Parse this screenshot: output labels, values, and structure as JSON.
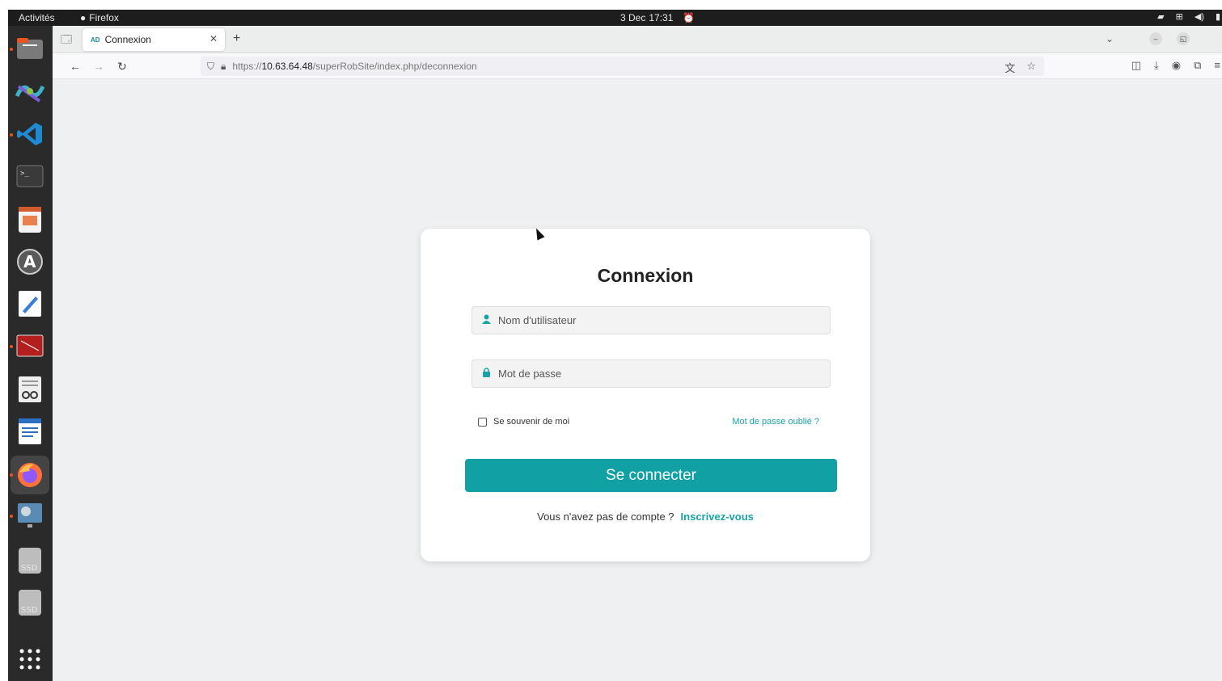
{
  "topbar": {
    "activities": "Activités",
    "app_name": "Firefox",
    "date": "3 Dec",
    "time": "17:31"
  },
  "dock": {
    "items": [
      {
        "icon": "files-icon"
      },
      {
        "icon": "ros-icon"
      },
      {
        "icon": "vscode-icon"
      },
      {
        "icon": "terminal-icon"
      },
      {
        "icon": "impress-icon"
      },
      {
        "icon": "software-icon"
      },
      {
        "icon": "text-editor-icon"
      },
      {
        "icon": "remote-desktop-icon"
      },
      {
        "icon": "document-viewer-icon"
      },
      {
        "icon": "writer-icon"
      },
      {
        "icon": "firefox-icon"
      },
      {
        "icon": "simulator-icon"
      },
      {
        "icon": "drive-icon",
        "label": "SSD"
      },
      {
        "icon": "drive-icon",
        "label": "SSD"
      },
      {
        "icon": "app-grid-icon"
      }
    ]
  },
  "browser": {
    "tab_title": "Connexion",
    "url_prefix": "https://",
    "url_host": "10.63.64.48",
    "url_path": "/superRobSite/index.php/deconnexion"
  },
  "login": {
    "title": "Connexion",
    "username_placeholder": "Nom d'utilisateur",
    "password_placeholder": "Mot de passe",
    "remember_label": "Se souvenir de moi",
    "forgot_label": "Mot de passe oublié ?",
    "submit_label": "Se connecter",
    "no_account_text": "Vous n'avez pas de compte ?",
    "signup_label": "Inscrivez-vous"
  },
  "colors": {
    "accent": "#11a0a3",
    "page_bg": "#eef0f1",
    "topbar_bg": "#1d1d1d",
    "dock_bg": "#2a2a2a"
  }
}
